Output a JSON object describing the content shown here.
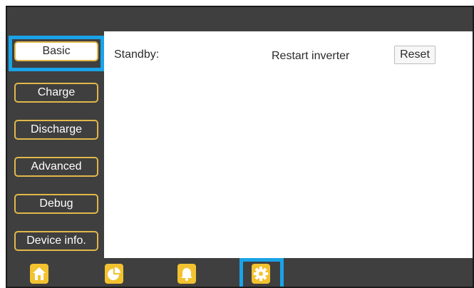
{
  "sidebar": {
    "items": [
      {
        "label": "Basic",
        "active": true
      },
      {
        "label": "Charge",
        "active": false
      },
      {
        "label": "Discharge",
        "active": false
      },
      {
        "label": "Advanced",
        "active": false
      },
      {
        "label": "Debug",
        "active": false
      },
      {
        "label": "Device info.",
        "active": false
      }
    ]
  },
  "main": {
    "standby_label": "Standby:",
    "restart_label": "Restart inverter",
    "reset_label": "Reset"
  },
  "bottom_nav": {
    "items": [
      {
        "icon": "home-icon",
        "active": false
      },
      {
        "icon": "pie-chart-icon",
        "active": false
      },
      {
        "icon": "bell-icon",
        "active": false
      },
      {
        "icon": "gear-icon",
        "active": true
      }
    ]
  },
  "colors": {
    "background": "#3f3f3f",
    "accent_border": "#e0b84a",
    "icon_fill": "#f2c230",
    "selection_highlight": "#1aa3e8"
  }
}
